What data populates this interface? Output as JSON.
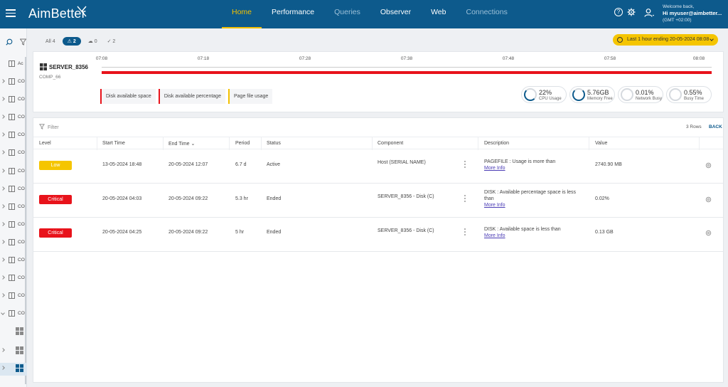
{
  "app": {
    "brand": "AimBetter",
    "nav": [
      {
        "label": "Home"
      },
      {
        "label": "Performance"
      },
      {
        "label": "Queries"
      },
      {
        "label": "Observer"
      },
      {
        "label": "Web"
      },
      {
        "label": "Connections"
      }
    ],
    "user": {
      "welcome": "Welcome back,",
      "greeting": "Hi myuser@aimbetter...",
      "timezone": "(GMT +02:00)"
    }
  },
  "sidebar": {
    "first_item": "Ac",
    "item_label": "CO"
  },
  "filters": {
    "all": "All 4",
    "alerts": "⚠ 2",
    "cloud": "☁ 0",
    "resolved": "✓ 2"
  },
  "time_range": {
    "label": "Last 1 hour ending",
    "value": "20-05-2024 08:08"
  },
  "server": {
    "name": "SERVER_8356",
    "comp": "COMP_66",
    "ticks": [
      "07:08",
      "07:18",
      "07:28",
      "07:38",
      "07:48",
      "07:58",
      "08:08"
    ],
    "legend": [
      "Disk available space",
      "Disk available percentage",
      "Page file usage"
    ],
    "metrics": [
      {
        "value": "22%",
        "label": "CPU Usage"
      },
      {
        "value": "5.76GB",
        "label": "Memory Free"
      },
      {
        "value": "0.01%",
        "label": "Network Busy"
      },
      {
        "value": "0.55%",
        "label": "Busy Time"
      }
    ]
  },
  "table": {
    "filter_placeholder": "Filter",
    "rows_count": "3 Rows",
    "back": "BACK",
    "headers": [
      "Level",
      "Start Time",
      "End Time ⌄",
      "Period",
      "Status",
      "Component",
      "Description",
      "Value"
    ],
    "more_info": "More Info",
    "rows": [
      {
        "level": "Low",
        "start": "13-05-2024 18:48",
        "end": "20-05-2024 12:07",
        "period": "6.7 d",
        "status": "Active",
        "component": "Host (SERIAL NAME)",
        "description": "PAGEFILE : Usage is more than",
        "value": "2740.90 MB"
      },
      {
        "level": "Critical",
        "start": "20-05-2024 04:03",
        "end": "20-05-2024 09:22",
        "period": "5.3 hr",
        "status": "Ended",
        "component": "SERVER_8356 - Disk (C)",
        "description": "DISK : Available percentage space is less than",
        "value": "0.02%"
      },
      {
        "level": "Critical",
        "start": "20-05-2024 04:25",
        "end": "20-05-2024 09:22",
        "period": "5 hr",
        "status": "Ended",
        "component": "SERVER_8356 - Disk (C)",
        "description": "DISK : Available space is less than",
        "value": "0.13 GB"
      }
    ]
  },
  "colors": {
    "brand": "#0d5a8c",
    "accent": "#f3c000",
    "critical": "#e8131b"
  }
}
